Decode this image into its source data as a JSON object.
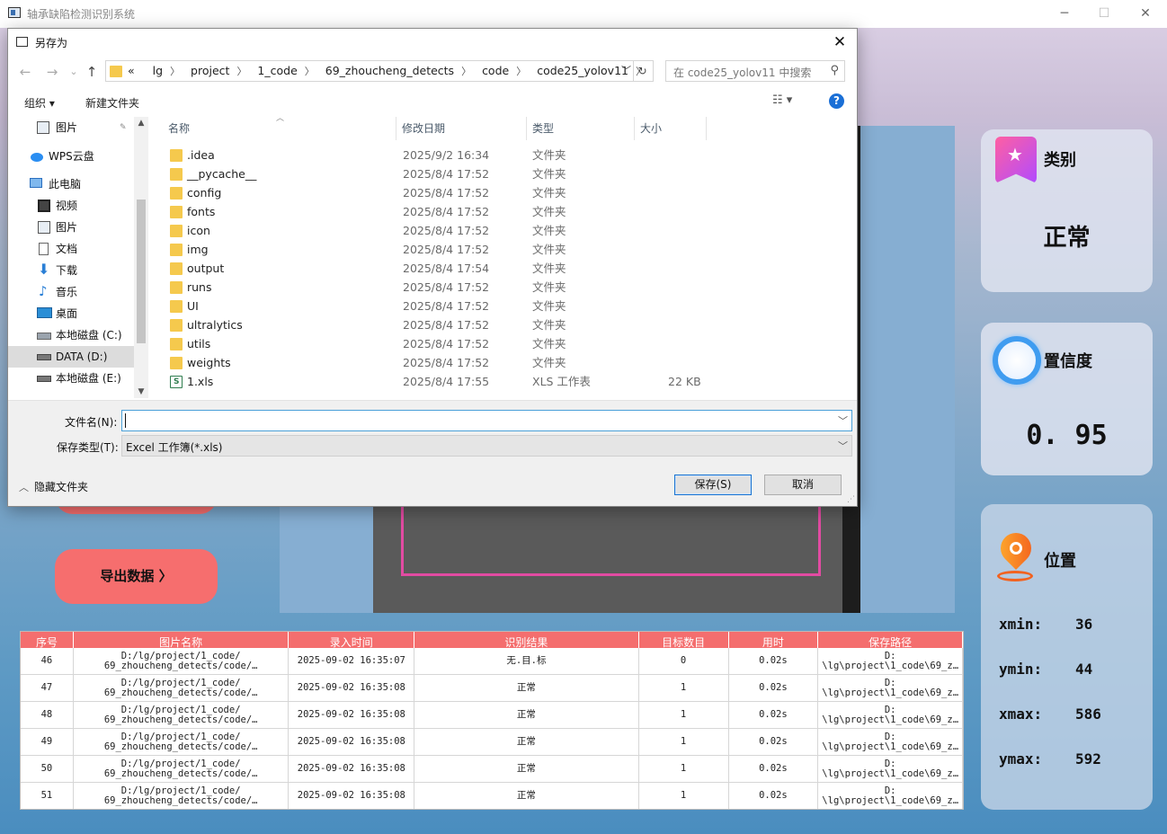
{
  "app": {
    "title": "轴承缺陷检测识别系统",
    "minimize": "─",
    "maximize": "☐",
    "close": "✕",
    "export_button": "导出数据 〉"
  },
  "cards": {
    "class_title": "类别",
    "class_value": "正常",
    "conf_title": "置信度",
    "conf_value": "0. 95",
    "pos_title": "位置",
    "xmin_label": "xmin:",
    "xmin": "36",
    "ymin_label": "ymin:",
    "ymin": "44",
    "xmax_label": "xmax:",
    "xmax": "586",
    "ymax_label": "ymax:",
    "ymax": "592"
  },
  "table": {
    "headers": [
      "序号",
      "图片名称",
      "录入时间",
      "识别结果",
      "目标数目",
      "用时",
      "保存路径"
    ],
    "rows": [
      {
        "id": "46",
        "name": "D:/lg/project/1_code/\n69_zhoucheng_detects/code/…",
        "time": "2025-09-02 16:35:07",
        "result": "无.目.标",
        "count": "0",
        "dur": "0.02s",
        "path": "D:\n\\lg\\project\\1_code\\69_z…"
      },
      {
        "id": "47",
        "name": "D:/lg/project/1_code/\n69_zhoucheng_detects/code/…",
        "time": "2025-09-02 16:35:08",
        "result": "正常",
        "count": "1",
        "dur": "0.02s",
        "path": "D:\n\\lg\\project\\1_code\\69_z…"
      },
      {
        "id": "48",
        "name": "D:/lg/project/1_code/\n69_zhoucheng_detects/code/…",
        "time": "2025-09-02 16:35:08",
        "result": "正常",
        "count": "1",
        "dur": "0.02s",
        "path": "D:\n\\lg\\project\\1_code\\69_z…"
      },
      {
        "id": "49",
        "name": "D:/lg/project/1_code/\n69_zhoucheng_detects/code/…",
        "time": "2025-09-02 16:35:08",
        "result": "正常",
        "count": "1",
        "dur": "0.02s",
        "path": "D:\n\\lg\\project\\1_code\\69_z…"
      },
      {
        "id": "50",
        "name": "D:/lg/project/1_code/\n69_zhoucheng_detects/code/…",
        "time": "2025-09-02 16:35:08",
        "result": "正常",
        "count": "1",
        "dur": "0.02s",
        "path": "D:\n\\lg\\project\\1_code\\69_z…"
      },
      {
        "id": "51",
        "name": "D:/lg/project/1_code/\n69_zhoucheng_detects/code/…",
        "time": "2025-09-02 16:35:08",
        "result": "正常",
        "count": "1",
        "dur": "0.02s",
        "path": "D:\n\\lg\\project\\1_code\\69_z…"
      }
    ]
  },
  "dialog": {
    "title": "另存为",
    "close": "✕",
    "back": "←",
    "forward": "→",
    "recent": "⌄",
    "up": "↑",
    "crumb_prefix": "«",
    "crumbs": [
      "lg",
      "project",
      "1_code",
      "69_zhoucheng_detects",
      "code",
      "code25_yolov11"
    ],
    "search_placeholder": "在 code25_yolov11 中搜索",
    "organize": "组织 ▾",
    "new_folder": "新建文件夹",
    "view": "☷ ▾",
    "help": "?",
    "nav_items": [
      {
        "label": "图片",
        "pin": "📌"
      },
      {
        "label": "WPS云盘"
      },
      {
        "label": "此电脑"
      },
      {
        "label": "视频"
      },
      {
        "label": "图片"
      },
      {
        "label": "文档"
      },
      {
        "label": "下载"
      },
      {
        "label": "音乐"
      },
      {
        "label": "桌面"
      },
      {
        "label": "本地磁盘 (C:)"
      },
      {
        "label": "DATA (D:)"
      },
      {
        "label": "本地磁盘 (E:)"
      }
    ],
    "columns": [
      "名称",
      "修改日期",
      "类型",
      "大小"
    ],
    "files": [
      {
        "name": ".idea",
        "date": "2025/9/2 16:34",
        "type": "文件夹",
        "size": ""
      },
      {
        "name": "__pycache__",
        "date": "2025/8/4 17:52",
        "type": "文件夹",
        "size": ""
      },
      {
        "name": "config",
        "date": "2025/8/4 17:52",
        "type": "文件夹",
        "size": ""
      },
      {
        "name": "fonts",
        "date": "2025/8/4 17:52",
        "type": "文件夹",
        "size": ""
      },
      {
        "name": "icon",
        "date": "2025/8/4 17:52",
        "type": "文件夹",
        "size": ""
      },
      {
        "name": "img",
        "date": "2025/8/4 17:52",
        "type": "文件夹",
        "size": ""
      },
      {
        "name": "output",
        "date": "2025/8/4 17:54",
        "type": "文件夹",
        "size": ""
      },
      {
        "name": "runs",
        "date": "2025/8/4 17:52",
        "type": "文件夹",
        "size": ""
      },
      {
        "name": "UI",
        "date": "2025/8/4 17:52",
        "type": "文件夹",
        "size": ""
      },
      {
        "name": "ultralytics",
        "date": "2025/8/4 17:52",
        "type": "文件夹",
        "size": ""
      },
      {
        "name": "utils",
        "date": "2025/8/4 17:52",
        "type": "文件夹",
        "size": ""
      },
      {
        "name": "weights",
        "date": "2025/8/4 17:52",
        "type": "文件夹",
        "size": ""
      },
      {
        "name": "1.xls",
        "date": "2025/8/4 17:55",
        "type": "XLS 工作表",
        "size": "22 KB"
      }
    ],
    "filename_label": "文件名(N):",
    "filename_value": "",
    "filetype_label": "保存类型(T):",
    "filetype_value": "Excel 工作簿(*.xls)",
    "hide_folders": "隐藏文件夹",
    "save": "保存(S)",
    "cancel": "取消"
  }
}
